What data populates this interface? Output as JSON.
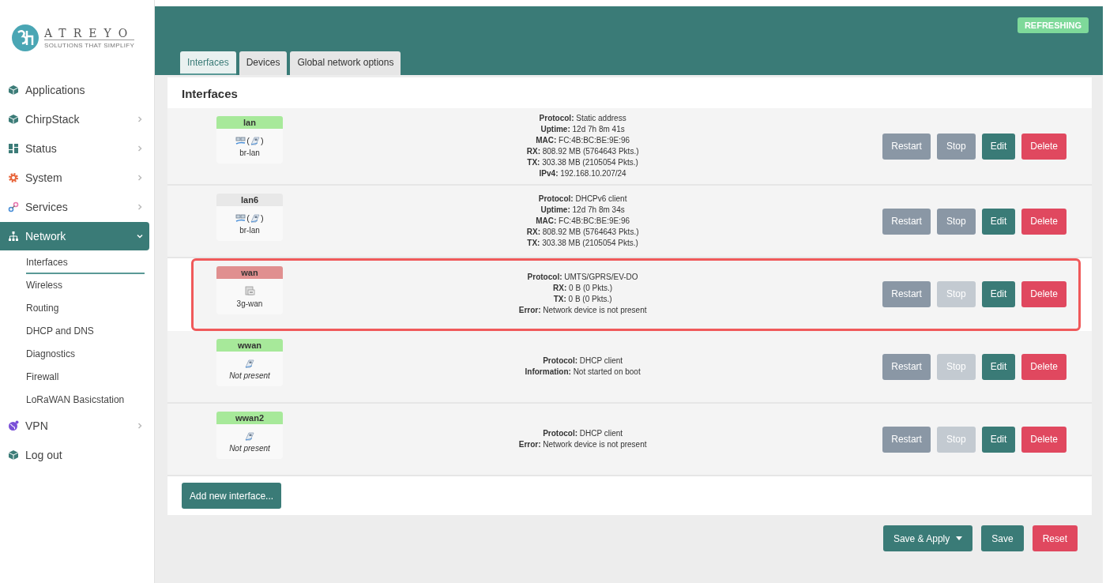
{
  "logo": {
    "name": "ATREYO",
    "tagline": "SOLUTIONS THAT SIMPLIFY"
  },
  "sidebar": {
    "items": [
      {
        "label": "Applications",
        "kind": "cube",
        "selected": false
      },
      {
        "label": "ChirpStack",
        "kind": "cube",
        "selected": false,
        "expanded": false
      },
      {
        "label": "Status",
        "kind": "grid",
        "selected": false,
        "expanded": false
      },
      {
        "label": "System",
        "kind": "gear",
        "selected": false,
        "expanded": false
      },
      {
        "label": "Services",
        "kind": "link",
        "selected": false,
        "expanded": false
      },
      {
        "label": "Network",
        "kind": "tree",
        "selected": true,
        "expanded": true,
        "children": [
          {
            "label": "Interfaces",
            "selected": true
          },
          {
            "label": "Wireless",
            "selected": false
          },
          {
            "label": "Routing",
            "selected": false
          },
          {
            "label": "DHCP and DNS",
            "selected": false
          },
          {
            "label": "Diagnostics",
            "selected": false
          },
          {
            "label": "Firewall",
            "selected": false
          },
          {
            "label": "LoRaWAN Basicstation",
            "selected": false
          }
        ]
      },
      {
        "label": "VPN",
        "kind": "globe",
        "selected": false,
        "expanded": false
      },
      {
        "label": "Log out",
        "kind": "cube",
        "selected": false
      }
    ]
  },
  "status_badge": "REFRESHING",
  "tabs": [
    {
      "label": "Interfaces",
      "selected": true
    },
    {
      "label": "Devices",
      "selected": false
    },
    {
      "label": "Global network options",
      "selected": false
    }
  ],
  "section_title": "Interfaces",
  "interfaces": [
    {
      "name": "lan",
      "color": "#a7e99a",
      "kind": "bridge",
      "bracket_open": "(",
      "bracket_close": ")",
      "device": "br-lan",
      "present": true,
      "highlighted": false,
      "details": [
        "**Protocol:** Static address",
        "**Uptime:** 12d 7h 8m 41s",
        "**MAC:** FC:4B:BC:BE:9E:96",
        "**RX:** 808.92 MB (5764643 Pkts.)",
        "**TX:** 303.38 MB (2105054 Pkts.)",
        "**IPv4:** 192.168.10.207/24"
      ],
      "buttons": [
        {
          "label": "Restart",
          "kind": "neutral",
          "disabled": false
        },
        {
          "label": "Stop",
          "kind": "neutral",
          "disabled": false
        },
        {
          "label": "Edit",
          "kind": "primary",
          "disabled": false
        },
        {
          "label": "Delete",
          "kind": "danger",
          "disabled": false
        }
      ]
    },
    {
      "name": "lan6",
      "color": "#e8e8e8",
      "kind": "bridge",
      "bracket_open": "(",
      "bracket_close": ")",
      "device": "br-lan",
      "present": true,
      "highlighted": false,
      "details": [
        "**Protocol:** DHCPv6 client",
        "**Uptime:** 12d 7h 8m 34s",
        "**MAC:** FC:4B:BC:BE:9E:96",
        "**RX:** 808.92 MB (5764643 Pkts.)",
        "**TX:** 303.38 MB (2105054 Pkts.)"
      ],
      "buttons": [
        {
          "label": "Restart",
          "kind": "neutral",
          "disabled": false
        },
        {
          "label": "Stop",
          "kind": "neutral",
          "disabled": false
        },
        {
          "label": "Edit",
          "kind": "primary",
          "disabled": false
        },
        {
          "label": "Delete",
          "kind": "danger",
          "disabled": false
        }
      ]
    },
    {
      "name": "wan",
      "color": "#e08f8f",
      "kind": "modem",
      "device": "3g-wan",
      "present": true,
      "highlighted": true,
      "details": [
        "**Protocol:** UMTS/GPRS/EV-DO",
        "**RX:** 0 B (0 Pkts.)",
        "**TX:** 0 B (0 Pkts.)",
        "**Error:** Network device is not present"
      ],
      "buttons": [
        {
          "label": "Restart",
          "kind": "neutral",
          "disabled": false
        },
        {
          "label": "Stop",
          "kind": "neutral",
          "disabled": true
        },
        {
          "label": "Edit",
          "kind": "primary",
          "disabled": false
        },
        {
          "label": "Delete",
          "kind": "danger",
          "disabled": false
        }
      ]
    },
    {
      "name": "wwan",
      "color": "#a7e99a",
      "kind": "ethernet",
      "device": "Not present",
      "present": false,
      "highlighted": false,
      "details": [
        "**Protocol:** DHCP client",
        "**Information:** Not started on boot"
      ],
      "buttons": [
        {
          "label": "Restart",
          "kind": "neutral",
          "disabled": false
        },
        {
          "label": "Stop",
          "kind": "neutral",
          "disabled": true
        },
        {
          "label": "Edit",
          "kind": "primary",
          "disabled": false
        },
        {
          "label": "Delete",
          "kind": "danger",
          "disabled": false
        }
      ]
    },
    {
      "name": "wwan2",
      "color": "#a7e99a",
      "kind": "ethernet",
      "device": "Not present",
      "present": false,
      "highlighted": false,
      "details": [
        "**Protocol:** DHCP client",
        "**Error:** Network device is not present"
      ],
      "buttons": [
        {
          "label": "Restart",
          "kind": "neutral",
          "disabled": false
        },
        {
          "label": "Stop",
          "kind": "neutral",
          "disabled": true
        },
        {
          "label": "Edit",
          "kind": "primary",
          "disabled": false
        },
        {
          "label": "Delete",
          "kind": "danger",
          "disabled": false
        }
      ]
    }
  ],
  "add_button": "Add new interface...",
  "footer_buttons": [
    {
      "label": "Save & Apply",
      "kind": "primary",
      "dropdown": true
    },
    {
      "label": "Save",
      "kind": "primary",
      "dropdown": false
    },
    {
      "label": "Reset",
      "kind": "danger",
      "dropdown": false
    }
  ]
}
